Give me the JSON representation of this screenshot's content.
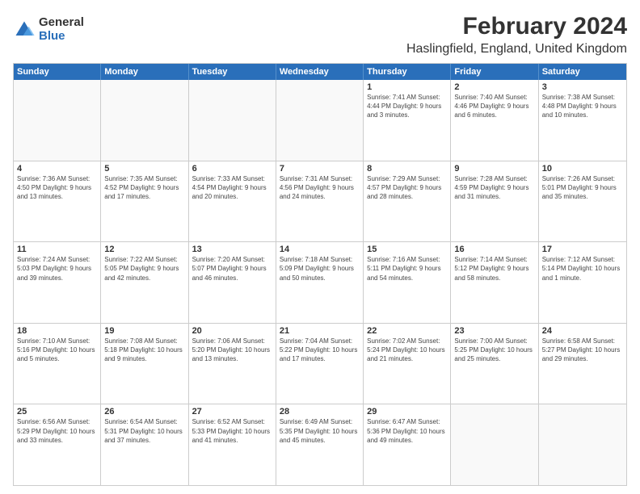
{
  "header": {
    "logo": {
      "general": "General",
      "blue": "Blue"
    },
    "title": "February 2024",
    "subtitle": "Haslingfield, England, United Kingdom"
  },
  "calendar": {
    "days": [
      "Sunday",
      "Monday",
      "Tuesday",
      "Wednesday",
      "Thursday",
      "Friday",
      "Saturday"
    ],
    "rows": [
      [
        {
          "day": "",
          "info": ""
        },
        {
          "day": "",
          "info": ""
        },
        {
          "day": "",
          "info": ""
        },
        {
          "day": "",
          "info": ""
        },
        {
          "day": "1",
          "info": "Sunrise: 7:41 AM\nSunset: 4:44 PM\nDaylight: 9 hours\nand 3 minutes."
        },
        {
          "day": "2",
          "info": "Sunrise: 7:40 AM\nSunset: 4:46 PM\nDaylight: 9 hours\nand 6 minutes."
        },
        {
          "day": "3",
          "info": "Sunrise: 7:38 AM\nSunset: 4:48 PM\nDaylight: 9 hours\nand 10 minutes."
        }
      ],
      [
        {
          "day": "4",
          "info": "Sunrise: 7:36 AM\nSunset: 4:50 PM\nDaylight: 9 hours\nand 13 minutes."
        },
        {
          "day": "5",
          "info": "Sunrise: 7:35 AM\nSunset: 4:52 PM\nDaylight: 9 hours\nand 17 minutes."
        },
        {
          "day": "6",
          "info": "Sunrise: 7:33 AM\nSunset: 4:54 PM\nDaylight: 9 hours\nand 20 minutes."
        },
        {
          "day": "7",
          "info": "Sunrise: 7:31 AM\nSunset: 4:56 PM\nDaylight: 9 hours\nand 24 minutes."
        },
        {
          "day": "8",
          "info": "Sunrise: 7:29 AM\nSunset: 4:57 PM\nDaylight: 9 hours\nand 28 minutes."
        },
        {
          "day": "9",
          "info": "Sunrise: 7:28 AM\nSunset: 4:59 PM\nDaylight: 9 hours\nand 31 minutes."
        },
        {
          "day": "10",
          "info": "Sunrise: 7:26 AM\nSunset: 5:01 PM\nDaylight: 9 hours\nand 35 minutes."
        }
      ],
      [
        {
          "day": "11",
          "info": "Sunrise: 7:24 AM\nSunset: 5:03 PM\nDaylight: 9 hours\nand 39 minutes."
        },
        {
          "day": "12",
          "info": "Sunrise: 7:22 AM\nSunset: 5:05 PM\nDaylight: 9 hours\nand 42 minutes."
        },
        {
          "day": "13",
          "info": "Sunrise: 7:20 AM\nSunset: 5:07 PM\nDaylight: 9 hours\nand 46 minutes."
        },
        {
          "day": "14",
          "info": "Sunrise: 7:18 AM\nSunset: 5:09 PM\nDaylight: 9 hours\nand 50 minutes."
        },
        {
          "day": "15",
          "info": "Sunrise: 7:16 AM\nSunset: 5:11 PM\nDaylight: 9 hours\nand 54 minutes."
        },
        {
          "day": "16",
          "info": "Sunrise: 7:14 AM\nSunset: 5:12 PM\nDaylight: 9 hours\nand 58 minutes."
        },
        {
          "day": "17",
          "info": "Sunrise: 7:12 AM\nSunset: 5:14 PM\nDaylight: 10 hours\nand 1 minute."
        }
      ],
      [
        {
          "day": "18",
          "info": "Sunrise: 7:10 AM\nSunset: 5:16 PM\nDaylight: 10 hours\nand 5 minutes."
        },
        {
          "day": "19",
          "info": "Sunrise: 7:08 AM\nSunset: 5:18 PM\nDaylight: 10 hours\nand 9 minutes."
        },
        {
          "day": "20",
          "info": "Sunrise: 7:06 AM\nSunset: 5:20 PM\nDaylight: 10 hours\nand 13 minutes."
        },
        {
          "day": "21",
          "info": "Sunrise: 7:04 AM\nSunset: 5:22 PM\nDaylight: 10 hours\nand 17 minutes."
        },
        {
          "day": "22",
          "info": "Sunrise: 7:02 AM\nSunset: 5:24 PM\nDaylight: 10 hours\nand 21 minutes."
        },
        {
          "day": "23",
          "info": "Sunrise: 7:00 AM\nSunset: 5:25 PM\nDaylight: 10 hours\nand 25 minutes."
        },
        {
          "day": "24",
          "info": "Sunrise: 6:58 AM\nSunset: 5:27 PM\nDaylight: 10 hours\nand 29 minutes."
        }
      ],
      [
        {
          "day": "25",
          "info": "Sunrise: 6:56 AM\nSunset: 5:29 PM\nDaylight: 10 hours\nand 33 minutes."
        },
        {
          "day": "26",
          "info": "Sunrise: 6:54 AM\nSunset: 5:31 PM\nDaylight: 10 hours\nand 37 minutes."
        },
        {
          "day": "27",
          "info": "Sunrise: 6:52 AM\nSunset: 5:33 PM\nDaylight: 10 hours\nand 41 minutes."
        },
        {
          "day": "28",
          "info": "Sunrise: 6:49 AM\nSunset: 5:35 PM\nDaylight: 10 hours\nand 45 minutes."
        },
        {
          "day": "29",
          "info": "Sunrise: 6:47 AM\nSunset: 5:36 PM\nDaylight: 10 hours\nand 49 minutes."
        },
        {
          "day": "",
          "info": ""
        },
        {
          "day": "",
          "info": ""
        }
      ]
    ]
  }
}
